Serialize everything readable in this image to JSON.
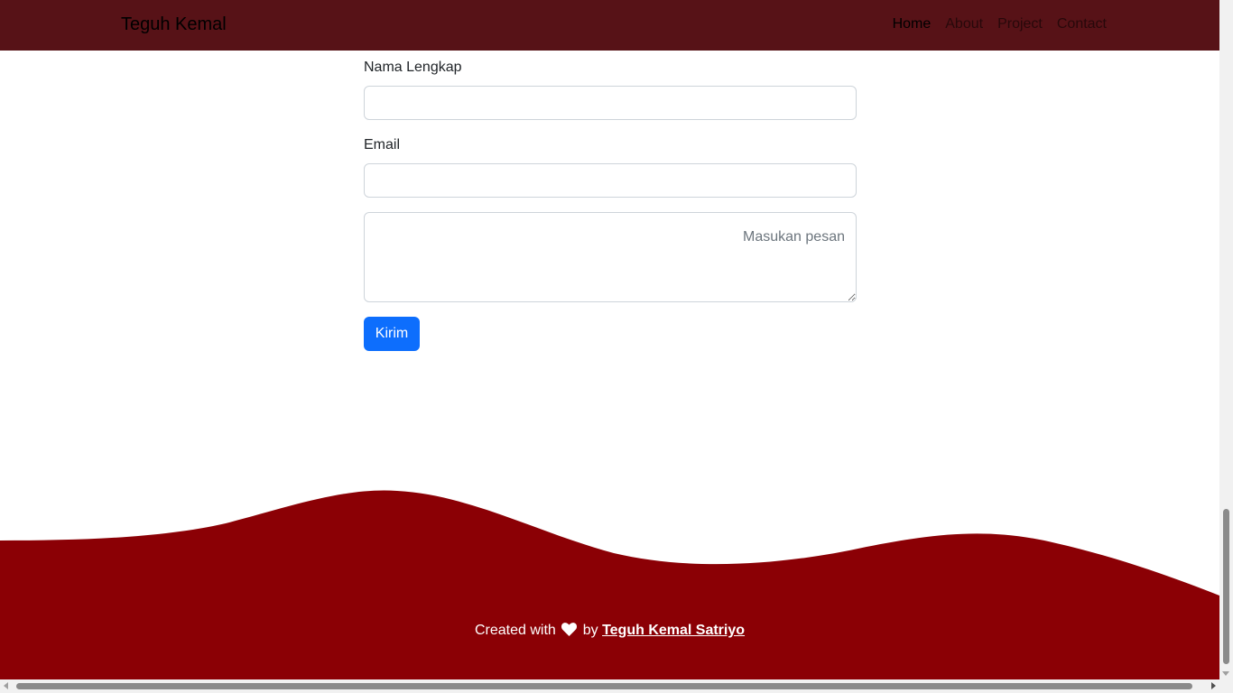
{
  "navbar": {
    "brand": "Teguh Kemal",
    "links": [
      {
        "label": "Home",
        "active": true
      },
      {
        "label": "About",
        "active": false
      },
      {
        "label": "Project",
        "active": false
      },
      {
        "label": "Contact",
        "active": false
      }
    ],
    "background_color": "#571217"
  },
  "contact_form": {
    "name_label": "Nama Lengkap",
    "name_value": "",
    "email_label": "Email",
    "email_value": "",
    "message_placeholder": "Masukan pesan",
    "message_value": "",
    "submit_label": "Kirim",
    "submit_color": "#0d6efd"
  },
  "footer": {
    "prefix": "Created with",
    "icon": "heart-icon",
    "middle": "by",
    "author": "Teguh Kemal Satriyo",
    "background_color": "#8b0005"
  }
}
